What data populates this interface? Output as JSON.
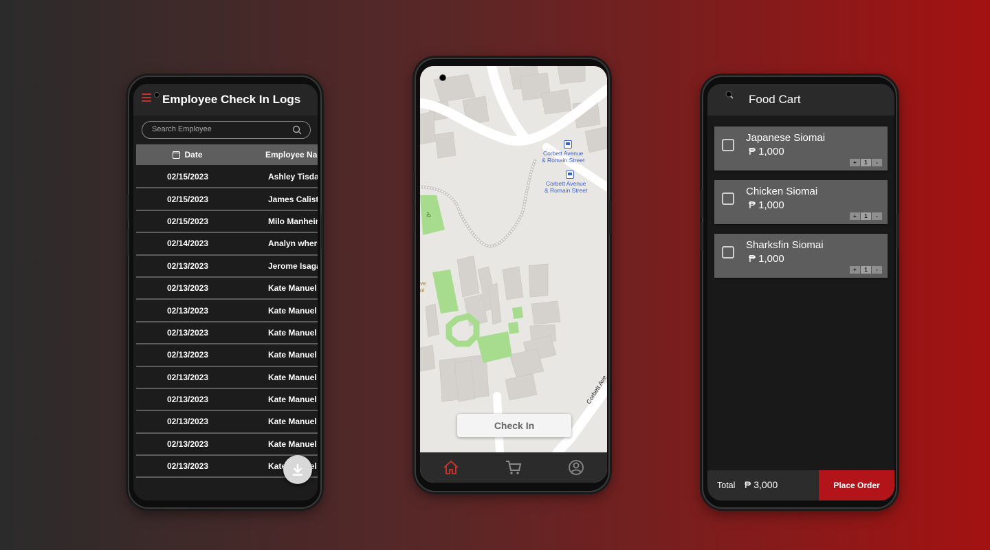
{
  "checkin_logs": {
    "title": "Employee Check In Logs",
    "search_placeholder": "Search Employee",
    "col_date": "Date",
    "col_name": "Employee Name",
    "rows": [
      {
        "date": "02/15/2023",
        "name": "Ashley Tisdale"
      },
      {
        "date": "02/15/2023",
        "name": "James Calisto"
      },
      {
        "date": "02/15/2023",
        "name": "Milo Manheim"
      },
      {
        "date": "02/14/2023",
        "name": "Analyn where"
      },
      {
        "date": "02/13/2023",
        "name": "Jerome Isaga"
      },
      {
        "date": "02/13/2023",
        "name": "Kate Manuel"
      },
      {
        "date": "02/13/2023",
        "name": "Kate Manuel"
      },
      {
        "date": "02/13/2023",
        "name": "Kate Manuel"
      },
      {
        "date": "02/13/2023",
        "name": "Kate Manuel"
      },
      {
        "date": "02/13/2023",
        "name": "Kate Manuel"
      },
      {
        "date": "02/13/2023",
        "name": "Kate Manuel"
      },
      {
        "date": "02/13/2023",
        "name": "Kate Manuel"
      },
      {
        "date": "02/13/2023",
        "name": "Kate Manuel"
      },
      {
        "date": "02/13/2023",
        "name": "Kate Manuel"
      }
    ],
    "icons": {
      "menu": "hamburger-icon",
      "search": "search-icon",
      "date": "calendar-icon",
      "download": "download-icon"
    },
    "accent": "#c3322b"
  },
  "map_screen": {
    "stop_label_1": "Corbett Avenue",
    "stop_label_1b": "& Romain Street",
    "stop_label_2": "Corbett Avenue",
    "stop_label_2b": "& Romain Street",
    "street_label": "Corbett Ave",
    "school_label_1": "ve",
    "school_label_2": "ol",
    "checkin_label": "Check In",
    "nav": [
      "home-icon",
      "cart-icon",
      "profile-icon"
    ],
    "active_color": "#c3322b"
  },
  "food_cart": {
    "title": "Food Cart",
    "items": [
      {
        "name": "Japanese Siomai",
        "price": "₱ 1,000",
        "qty": "1"
      },
      {
        "name": "Chicken Siomai",
        "price": "₱ 1,000",
        "qty": "1"
      },
      {
        "name": "Sharksfin Siomai",
        "price": "₱ 1,000",
        "qty": "1"
      }
    ],
    "stepper_plus": "+",
    "stepper_minus": "-",
    "total_label": "Total",
    "total_value": "₱ 3,000",
    "place_order": "Place Order",
    "accent": "#b3141a"
  }
}
